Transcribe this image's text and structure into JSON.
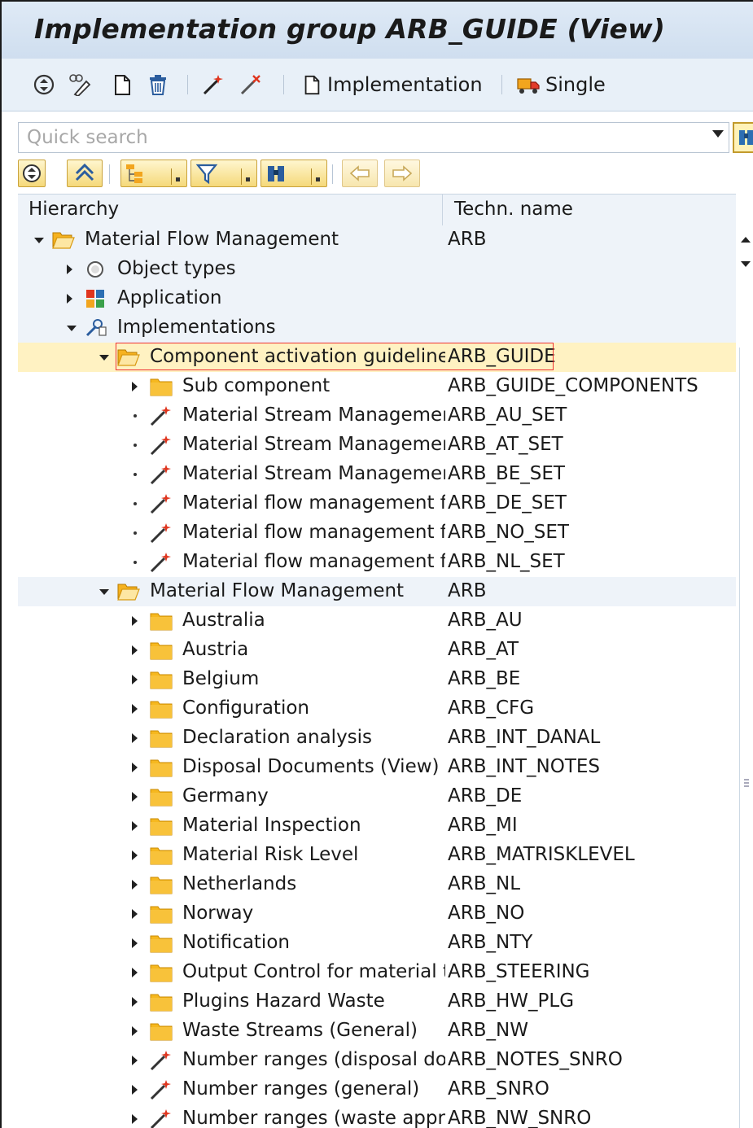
{
  "window": {
    "title": "Implementation group ARB_GUIDE (View)"
  },
  "toolbar": {
    "icons": [
      "refresh-icon",
      "display-change-icon",
      "new-document-icon",
      "delete-icon",
      "wand-icon",
      "wand-remove-icon"
    ],
    "implementation_label": "Implementation",
    "single_label": "Single"
  },
  "search": {
    "placeholder": "Quick search",
    "value": ""
  },
  "tree_toolbar": {
    "icons": [
      "refresh-icon",
      "collapse-icon",
      "hierarchy-icon",
      "filter-icon",
      "find-icon",
      "back-arrow-icon",
      "forward-arrow-icon"
    ]
  },
  "columns": {
    "hierarchy": "Hierarchy",
    "techn_name": "Techn. name"
  },
  "rows": [
    {
      "label": "Material Flow Management",
      "tech": "ARB",
      "level": 0,
      "state": "expanded",
      "icon": "folder-open"
    },
    {
      "label": "Object types",
      "tech": "",
      "level": 1,
      "state": "collapsed",
      "icon": "circle"
    },
    {
      "label": "Application",
      "tech": "",
      "level": 1,
      "state": "collapsed",
      "icon": "app"
    },
    {
      "label": "Implementations",
      "tech": "",
      "level": 1,
      "state": "expanded",
      "icon": "wrench"
    },
    {
      "label": "Component activation guideline",
      "tech": "ARB_GUIDE",
      "level": 2,
      "state": "expanded",
      "icon": "folder-open",
      "selected": true
    },
    {
      "label": "Sub component",
      "tech": "ARB_GUIDE_COMPONENTS",
      "level": 3,
      "state": "collapsed",
      "icon": "folder"
    },
    {
      "label": "Material Stream Management",
      "tech": "ARB_AU_SET",
      "level": 3,
      "state": "leaf",
      "icon": "wand"
    },
    {
      "label": "Material Stream Management",
      "tech": "ARB_AT_SET",
      "level": 3,
      "state": "leaf",
      "icon": "wand"
    },
    {
      "label": "Material Stream Management",
      "tech": "ARB_BE_SET",
      "level": 3,
      "state": "leaf",
      "icon": "wand"
    },
    {
      "label": "Material flow management fo",
      "tech": "ARB_DE_SET",
      "level": 3,
      "state": "leaf",
      "icon": "wand"
    },
    {
      "label": "Material flow management fo",
      "tech": "ARB_NO_SET",
      "level": 3,
      "state": "leaf",
      "icon": "wand"
    },
    {
      "label": "Material flow management fo",
      "tech": "ARB_NL_SET",
      "level": 3,
      "state": "leaf",
      "icon": "wand"
    },
    {
      "label": "Material Flow Management",
      "tech": "ARB",
      "level": 2,
      "state": "expanded",
      "icon": "folder-open"
    },
    {
      "label": "Australia",
      "tech": "ARB_AU",
      "level": 3,
      "state": "collapsed",
      "icon": "folder"
    },
    {
      "label": "Austria",
      "tech": "ARB_AT",
      "level": 3,
      "state": "collapsed",
      "icon": "folder"
    },
    {
      "label": "Belgium",
      "tech": "ARB_BE",
      "level": 3,
      "state": "collapsed",
      "icon": "folder"
    },
    {
      "label": "Configuration",
      "tech": "ARB_CFG",
      "level": 3,
      "state": "collapsed",
      "icon": "folder"
    },
    {
      "label": "Declaration analysis",
      "tech": "ARB_INT_DANAL",
      "level": 3,
      "state": "collapsed",
      "icon": "folder"
    },
    {
      "label": "Disposal Documents (View)",
      "tech": "ARB_INT_NOTES",
      "level": 3,
      "state": "collapsed",
      "icon": "folder"
    },
    {
      "label": "Germany",
      "tech": "ARB_DE",
      "level": 3,
      "state": "collapsed",
      "icon": "folder"
    },
    {
      "label": "Material Inspection",
      "tech": "ARB_MI",
      "level": 3,
      "state": "collapsed",
      "icon": "folder"
    },
    {
      "label": "Material Risk Level",
      "tech": "ARB_MATRISKLEVEL",
      "level": 3,
      "state": "collapsed",
      "icon": "folder"
    },
    {
      "label": "Netherlands",
      "tech": "ARB_NL",
      "level": 3,
      "state": "collapsed",
      "icon": "folder"
    },
    {
      "label": "Norway",
      "tech": "ARB_NO",
      "level": 3,
      "state": "collapsed",
      "icon": "folder"
    },
    {
      "label": "Notification",
      "tech": "ARB_NTY",
      "level": 3,
      "state": "collapsed",
      "icon": "folder"
    },
    {
      "label": "Output Control for material t",
      "tech": "ARB_STEERING",
      "level": 3,
      "state": "collapsed",
      "icon": "folder"
    },
    {
      "label": "Plugins Hazard Waste",
      "tech": "ARB_HW_PLG",
      "level": 3,
      "state": "collapsed",
      "icon": "folder"
    },
    {
      "label": "Waste Streams (General)",
      "tech": "ARB_NW",
      "level": 3,
      "state": "collapsed",
      "icon": "folder"
    },
    {
      "label": "Number ranges (disposal doc",
      "tech": "ARB_NOTES_SNRO",
      "level": 3,
      "state": "collapsed",
      "icon": "wand"
    },
    {
      "label": "Number ranges (general)",
      "tech": "ARB_SNRO",
      "level": 3,
      "state": "collapsed",
      "icon": "wand"
    },
    {
      "label": "Number ranges (waste apprc",
      "tech": "ARB_NW_SNRO",
      "level": 3,
      "state": "collapsed",
      "icon": "wand"
    }
  ],
  "colors": {
    "accent": "#f5c542",
    "selection_border": "#e33333",
    "header_bg": "#dfeaf6"
  }
}
